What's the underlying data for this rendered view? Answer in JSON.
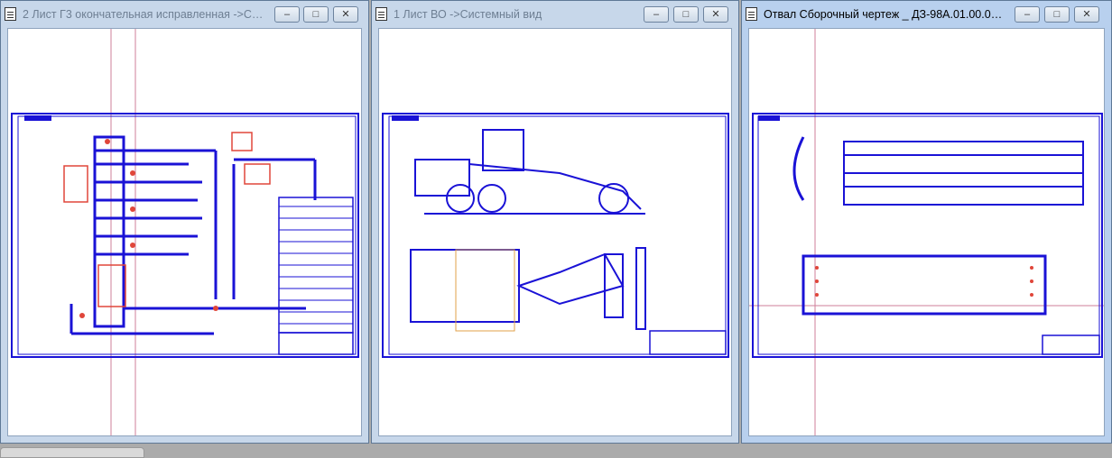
{
  "windows": [
    {
      "title": "2 Лист Г3 окончательная исправленная ->Сист...",
      "active": false
    },
    {
      "title": "1 Лист ВО ->Системный вид",
      "active": false
    },
    {
      "title": "Отвал Сборочный чертеж _  ДЗ-98А.01.00.000 ...",
      "active": true
    }
  ],
  "controls": {
    "minimize": "–",
    "maximize": "□",
    "close": "✕"
  },
  "colors": {
    "drawing": "#1a12d6",
    "accent": "#e0463a",
    "guide": "#cf7f9a"
  }
}
